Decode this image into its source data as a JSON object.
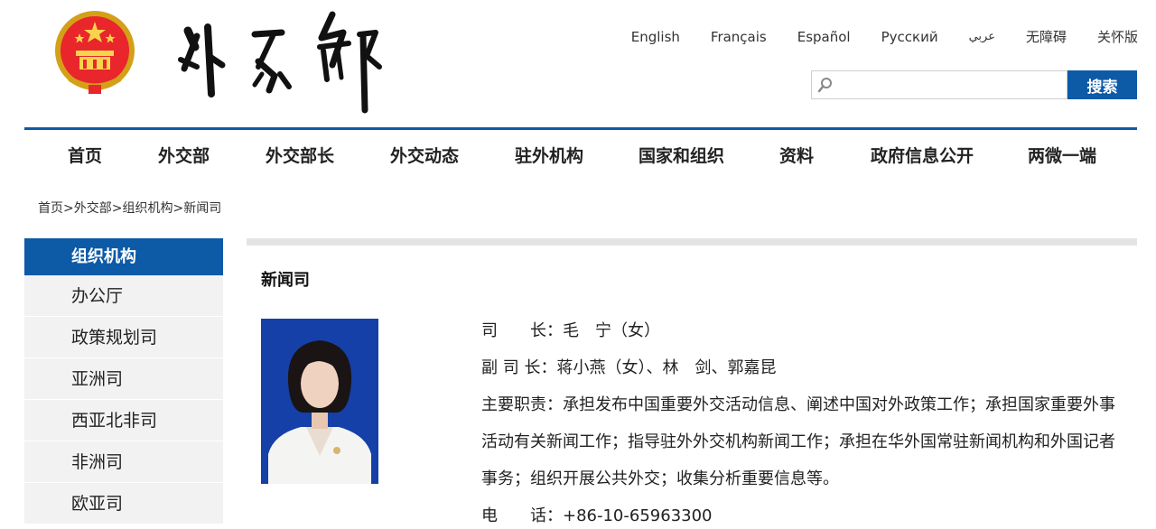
{
  "header": {
    "languages": [
      "English",
      "Français",
      "Español",
      "Русский",
      "عربي",
      "无障碍",
      "关怀版"
    ],
    "search": {
      "placeholder": "",
      "button_label": "搜索"
    }
  },
  "nav": [
    "首页",
    "外交部",
    "外交部长",
    "外交动态",
    "驻外机构",
    "国家和组织",
    "资料",
    "政府信息公开",
    "两微一端"
  ],
  "breadcrumb": "首页>外交部>组织机构>新闻司",
  "sidebar": {
    "title": "组织机构",
    "items": [
      "办公厅",
      "政策规划司",
      "亚洲司",
      "西亚北非司",
      "非洲司",
      "欧亚司"
    ]
  },
  "content": {
    "title": "新闻司",
    "director_label": "司　　长：",
    "director_value": "毛　宁（女）",
    "deputy_label": "副 司 长：",
    "deputy_value": "蒋小燕（女）、林　剑、郭嘉昆",
    "duties_label": "主要职责：",
    "duties_value": "承担发布中国重要外交活动信息、阐述中国对外政策工作；承担国家重要外事活动有关新闻工作；指导驻外外交机构新闻工作；承担在华外国常驻新闻机构和外国记者事务；组织开展公共外交；收集分析重要信息等。",
    "phone_label": "电　　话：",
    "phone_value": "+86-10-65963300"
  },
  "colors": {
    "brand_blue": "#0d5aa7",
    "sidebar_bg": "#f2f2f2"
  }
}
